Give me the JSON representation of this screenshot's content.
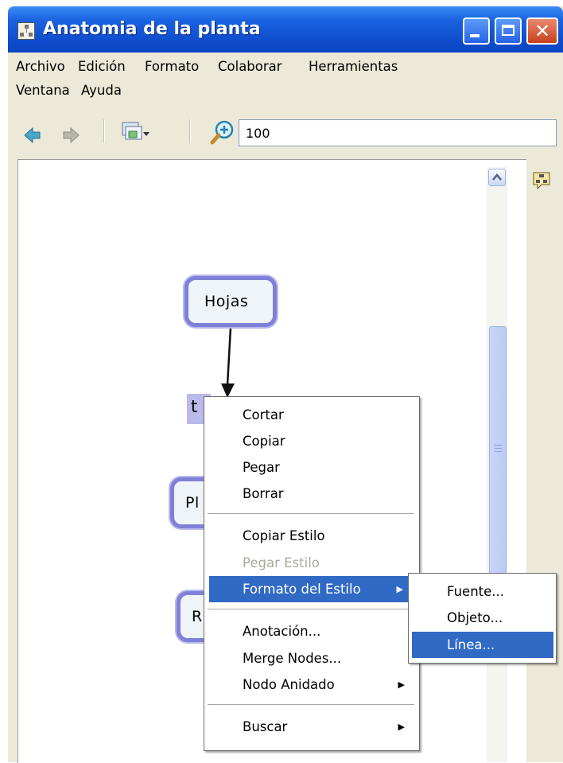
{
  "window": {
    "title": "Anatomia de la planta"
  },
  "menubar": [
    {
      "label": "Archivo"
    },
    {
      "label": "Edición"
    },
    {
      "label": "Formato"
    },
    {
      "label": "Colaborar"
    },
    {
      "label": "Herramientas"
    },
    {
      "label": "Ventana"
    },
    {
      "label": "Ayuda"
    }
  ],
  "toolbar": {
    "icons": [
      "back-arrow-icon",
      "forward-arrow-icon",
      "view-menu-icon",
      "zoom-icon"
    ],
    "zoom_value": "100"
  },
  "concept_map": {
    "nodes": [
      {
        "label": "Hojas"
      },
      {
        "label": "t"
      },
      {
        "label": "Pl"
      },
      {
        "label": "R"
      }
    ]
  },
  "context_menu": {
    "items": [
      {
        "label": "Cortar"
      },
      {
        "label": "Copiar"
      },
      {
        "label": "Pegar"
      },
      {
        "label": "Borrar"
      },
      {
        "label": "Copiar Estilo"
      },
      {
        "label": "Pegar Estilo",
        "disabled": true
      },
      {
        "label": "Formato del Estilo",
        "highlighted": true,
        "submenu": true
      },
      {
        "label": "Anotación..."
      },
      {
        "label": "Merge Nodes..."
      },
      {
        "label": "Nodo Anidado",
        "submenu": true
      },
      {
        "label": "Buscar",
        "submenu": true
      }
    ]
  },
  "submenu": {
    "items": [
      {
        "label": "Fuente..."
      },
      {
        "label": "Objeto..."
      },
      {
        "label": "Línea...",
        "highlighted": true
      }
    ]
  },
  "colors": {
    "titlebar": "#0f4fd0",
    "highlight": "#316ac5",
    "node_border": "#8080d8",
    "disabled_text": "#aca899"
  }
}
